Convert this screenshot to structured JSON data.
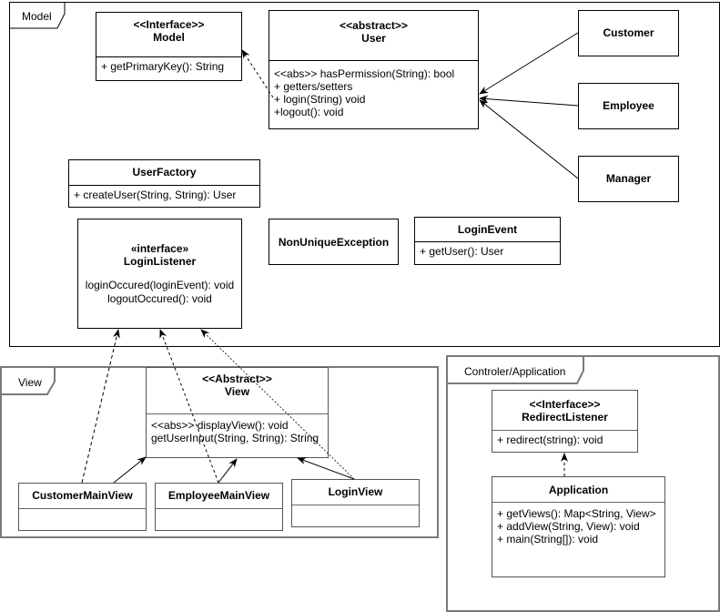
{
  "packages": {
    "model": "Model",
    "view": "View",
    "controller": "Controler/Application"
  },
  "classes": {
    "model": {
      "stereotype": "<<Interface>>",
      "name": "Model",
      "ops": [
        "+ getPrimaryKey(): String"
      ]
    },
    "user": {
      "stereotype": "<<abstract>>",
      "name": "User",
      "ops": [
        "<<abs>> hasPermission(String): bool",
        "+ getters/setters",
        "+ login(String) void",
        "+logout(): void"
      ]
    },
    "customer": {
      "name": "Customer"
    },
    "employee": {
      "name": "Employee"
    },
    "manager": {
      "name": "Manager"
    },
    "userFactory": {
      "name": "UserFactory",
      "ops": [
        "+ createUser(String, String): User"
      ]
    },
    "loginListener": {
      "stereotype": "«interface»",
      "name": "LoginListener",
      "ops": [
        "loginOccured(loginEvent): void",
        "logoutOccured(): void"
      ]
    },
    "nonUniqueException": {
      "name": "NonUniqueException"
    },
    "loginEvent": {
      "name": "LoginEvent",
      "ops": [
        "+ getUser(): User"
      ]
    },
    "view": {
      "stereotype": "<<Abstract>>",
      "name": "View",
      "ops": [
        "<<abs>> displayView(): void",
        "getUserInput(String, String): String"
      ]
    },
    "customerMainView": {
      "name": "CustomerMainView"
    },
    "employeeMainView": {
      "name": "EmployeeMainView"
    },
    "loginView": {
      "name": "LoginView"
    },
    "redirectListener": {
      "stereotype": "<<Interface>>",
      "name": "RedirectListener",
      "ops": [
        "+ redirect(string): void"
      ]
    },
    "application": {
      "name": "Application",
      "ops": [
        "+ getViews(): Map<String, View>",
        "+ addView(String, View): void",
        "+ main(String[]): void"
      ]
    }
  },
  "relations": [
    {
      "from": "User",
      "to": "Model",
      "type": "realization"
    },
    {
      "from": "Customer",
      "to": "User",
      "type": "generalization"
    },
    {
      "from": "Employee",
      "to": "User",
      "type": "generalization"
    },
    {
      "from": "Manager",
      "to": "User",
      "type": "generalization"
    },
    {
      "from": "CustomerMainView",
      "to": "View",
      "type": "generalization"
    },
    {
      "from": "EmployeeMainView",
      "to": "View",
      "type": "generalization"
    },
    {
      "from": "LoginView",
      "to": "View",
      "type": "generalization"
    },
    {
      "from": "CustomerMainView",
      "to": "LoginListener",
      "type": "realization"
    },
    {
      "from": "EmployeeMainView",
      "to": "LoginListener",
      "type": "realization"
    },
    {
      "from": "LoginView",
      "to": "LoginListener",
      "type": "realization"
    },
    {
      "from": "Application",
      "to": "RedirectListener",
      "type": "realization"
    }
  ]
}
